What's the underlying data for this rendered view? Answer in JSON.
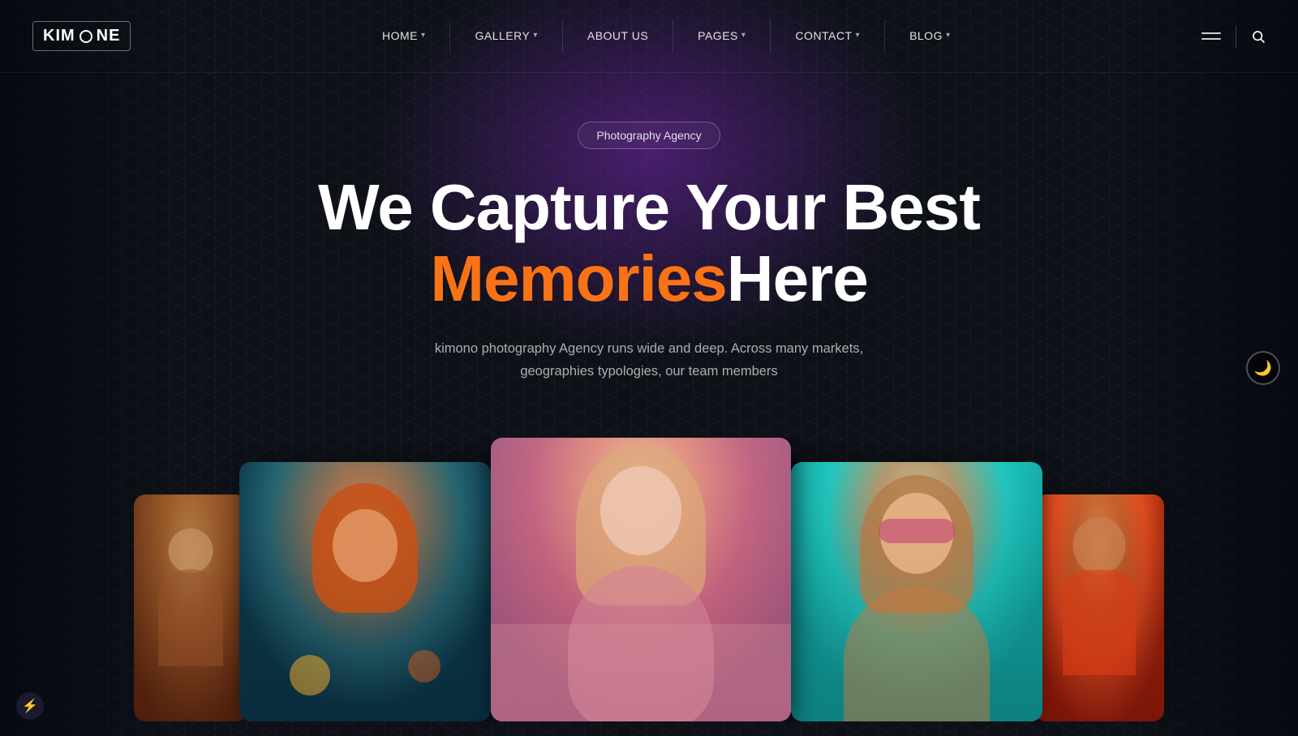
{
  "logo": {
    "text_before": "KIM",
    "text_after": "NE",
    "full": "KIM◎NE"
  },
  "nav": {
    "links": [
      {
        "label": "HOME",
        "has_dropdown": true,
        "id": "home"
      },
      {
        "label": "GALLERY",
        "has_dropdown": true,
        "id": "gallery"
      },
      {
        "label": "ABOUT US",
        "has_dropdown": false,
        "id": "about"
      },
      {
        "label": "PAGES",
        "has_dropdown": true,
        "id": "pages"
      },
      {
        "label": "CONTACT",
        "has_dropdown": true,
        "id": "contact"
      },
      {
        "label": "BLOG",
        "has_dropdown": true,
        "id": "blog"
      }
    ]
  },
  "hero": {
    "badge": "Photography Agency",
    "title_line1": "We Capture Your Best",
    "title_memories": "Memories",
    "title_here": " Here",
    "description": "kimono photography Agency runs wide and deep. Across many markets, geographies typologies, our team members"
  },
  "photos": [
    {
      "id": 1,
      "alt": "Woman portrait warm tones",
      "css_class": "img-1"
    },
    {
      "id": 2,
      "alt": "Redhead girl underwater",
      "css_class": "img-2"
    },
    {
      "id": 3,
      "alt": "Blonde woman in pink flowers",
      "css_class": "img-3"
    },
    {
      "id": 4,
      "alt": "Woman with sunglasses teal background",
      "css_class": "img-4"
    },
    {
      "id": 5,
      "alt": "Woman in orange on street",
      "css_class": "img-5"
    }
  ],
  "colors": {
    "accent_orange": "#f97316",
    "accent_pink": "#e91e8c",
    "bg_dark": "#0d1117",
    "nav_divider": "rgba(255,255,255,0.08)"
  },
  "watermark": {
    "icon": "⚡",
    "label": "lightning-icon"
  }
}
